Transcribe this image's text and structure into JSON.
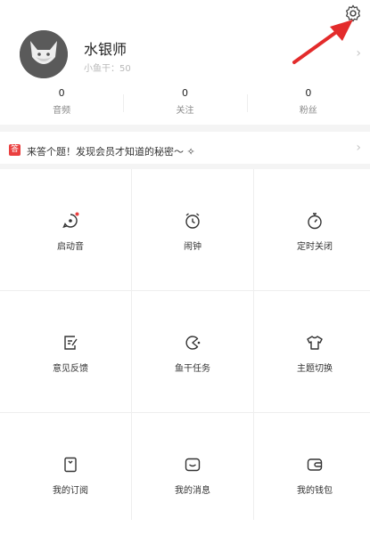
{
  "profile": {
    "name": "水银师",
    "subtitle": "小鱼干：50",
    "chevron": "›"
  },
  "stats": [
    {
      "value": "0",
      "label": "音频"
    },
    {
      "value": "0",
      "label": "关注"
    },
    {
      "value": "0",
      "label": "粉丝"
    }
  ],
  "banner": {
    "badge": "答",
    "text": "来答个题！发现会员才知道的秘密～ ✧",
    "chevron": "›"
  },
  "grid": [
    {
      "label": "启动音",
      "icon": "startup-sound-icon"
    },
    {
      "label": "闹钟",
      "icon": "alarm-clock-icon"
    },
    {
      "label": "定时关闭",
      "icon": "timer-icon"
    },
    {
      "label": "意见反馈",
      "icon": "feedback-icon"
    },
    {
      "label": "鱼干任务",
      "icon": "fish-task-icon"
    },
    {
      "label": "主题切换",
      "icon": "theme-shirt-icon"
    },
    {
      "label": "我的订阅",
      "icon": "subscription-icon"
    },
    {
      "label": "我的消息",
      "icon": "message-icon"
    },
    {
      "label": "我的钱包",
      "icon": "wallet-icon"
    }
  ],
  "colors": {
    "accent": "#ea3f3f",
    "arrow": "#e32b2b"
  }
}
